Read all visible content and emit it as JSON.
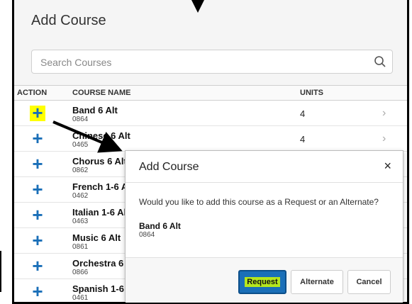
{
  "page": {
    "title": "Add Course",
    "search_placeholder": "Search Courses"
  },
  "table": {
    "headers": {
      "action": "ACTION",
      "course_name": "COURSE NAME",
      "units": "UNITS"
    },
    "rows": [
      {
        "name": "Band 6 Alt",
        "code": "0864",
        "units": "4",
        "highlighted": true
      },
      {
        "name": "Chinese 6 Alt",
        "code": "0465",
        "units": "4"
      },
      {
        "name": "Chorus 6 Alt",
        "code": "0862",
        "units": ""
      },
      {
        "name": "French 1-6 Alt",
        "code": "0462",
        "units": ""
      },
      {
        "name": "Italian 1-6 Alt",
        "code": "0463",
        "units": ""
      },
      {
        "name": "Music 6 Alt",
        "code": "0861",
        "units": ""
      },
      {
        "name": "Orchestra 6 Alt",
        "code": "0866",
        "units": ""
      },
      {
        "name": "Spanish 1-6 Alt",
        "code": "0461",
        "units": ""
      }
    ]
  },
  "modal": {
    "title": "Add Course",
    "close_label": "×",
    "question": "Would you like to add this course as a Request or an Alternate?",
    "course_name": "Band 6 Alt",
    "course_code": "0864",
    "buttons": {
      "request": "Request",
      "alternate": "Alternate",
      "cancel": "Cancel"
    }
  },
  "icons": {
    "add": "plus-icon",
    "search": "search-icon",
    "chevron": "chevron-right-icon",
    "close": "close-icon"
  },
  "colors": {
    "accent": "#1a6fb8",
    "highlight": "#ffff00",
    "request_text_highlight": "#b5e61d"
  }
}
